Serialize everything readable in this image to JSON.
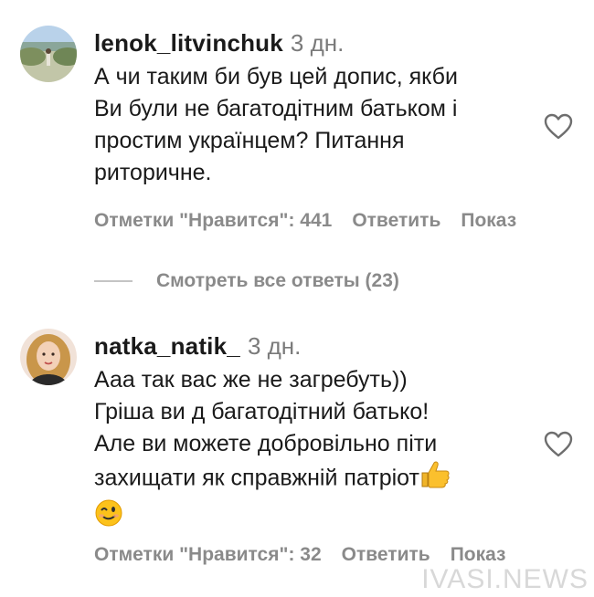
{
  "comments": [
    {
      "username": "lenok_litvinchuk",
      "time": "3 дн.",
      "lines": [
        "А чи таким би був цей допис, якби",
        "Ви були не багатодітним батьком і",
        "простим українцем? Питання",
        "риторичне."
      ],
      "likes_label": "Отметки \"Нравится\": 441",
      "reply_label": "Ответить",
      "more_label": "Показ"
    },
    {
      "username": "natka_natik_",
      "time": "3 дн.",
      "lines": [
        "Ааа так вас же не загребуть))",
        "Гріша ви д багатодітний батько!",
        "Але ви можете добровільно піти",
        "захищати як справжній патріот"
      ],
      "likes_label": "Отметки \"Нравится\": 32",
      "reply_label": "Ответить",
      "more_label": "Показ"
    }
  ],
  "view_replies_label": "Смотреть все ответы (23)",
  "watermark": "IVASI.NEWS",
  "icons": {
    "like": "heart-outline-icon",
    "emoji_thumbs": "thumbs-up-emoji",
    "emoji_wink": "winking-face-emoji"
  }
}
